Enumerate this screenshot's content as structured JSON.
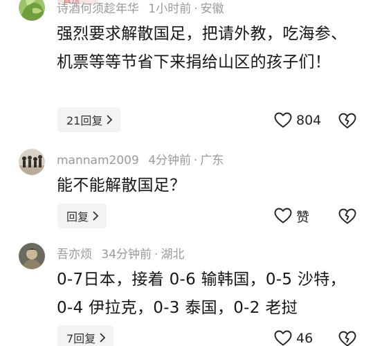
{
  "comments": [
    {
      "tag": "置顶",
      "user": "诗酒何须趁年华",
      "time": "1小时前",
      "location": "安徽",
      "text": "强烈要求解散国足，把请外教，吃海参、机票等等节省下来捐给山区的孩子们！",
      "reply_label": "21回复",
      "like_label": "804"
    },
    {
      "user": "mannam2009",
      "time": "4分钟前",
      "location": "广东",
      "text": "能不能解散国足？",
      "reply_label": "回复",
      "like_label": "赞"
    },
    {
      "user": "吾亦烦",
      "time": "34分钟前",
      "location": "湖北",
      "text": "0-7日本，接着 0-6 输韩国，0-5 沙特，0-4 伊拉克，0-3 泰国，0-2 老挝",
      "reply_label": "7回复",
      "like_label": "46"
    }
  ],
  "icons": {
    "like": "heart-outline-icon",
    "dislike": "broken-heart-icon",
    "chevron": "chevron-right-icon"
  },
  "colors": {
    "meta": "#9a9a9a",
    "text": "#161616",
    "reply_bg": "#f3f3f3"
  }
}
